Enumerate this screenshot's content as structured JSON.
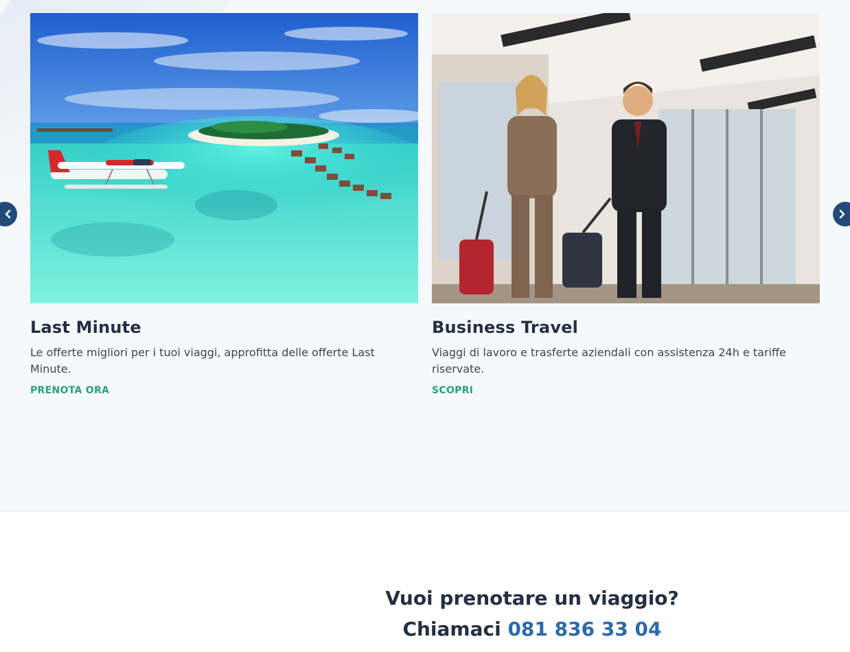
{
  "cards": [
    {
      "title": "Last Minute",
      "text": "Le offerte migliori per i tuoi viaggi, approfitta delle offerte Last Minute.",
      "link": "PRENOTA ORA"
    },
    {
      "title": "Business Travel",
      "text": "Viaggi di lavoro e trasferte aziendali con assistenza 24h e tariffe riservate.",
      "link": "SCOPRI"
    }
  ],
  "cta": {
    "question": "Vuoi prenotare un viaggio?",
    "call_label": "Chiamaci",
    "phone": "081 836 33 04"
  },
  "colors": {
    "heading": "#233041",
    "link_green": "#26a27a",
    "arrow_bg": "#224b7a",
    "phone_blue": "#2b6aa8"
  },
  "icons": {
    "carousel_prev": "chevron-left-icon",
    "carousel_next": "chevron-right-icon"
  }
}
